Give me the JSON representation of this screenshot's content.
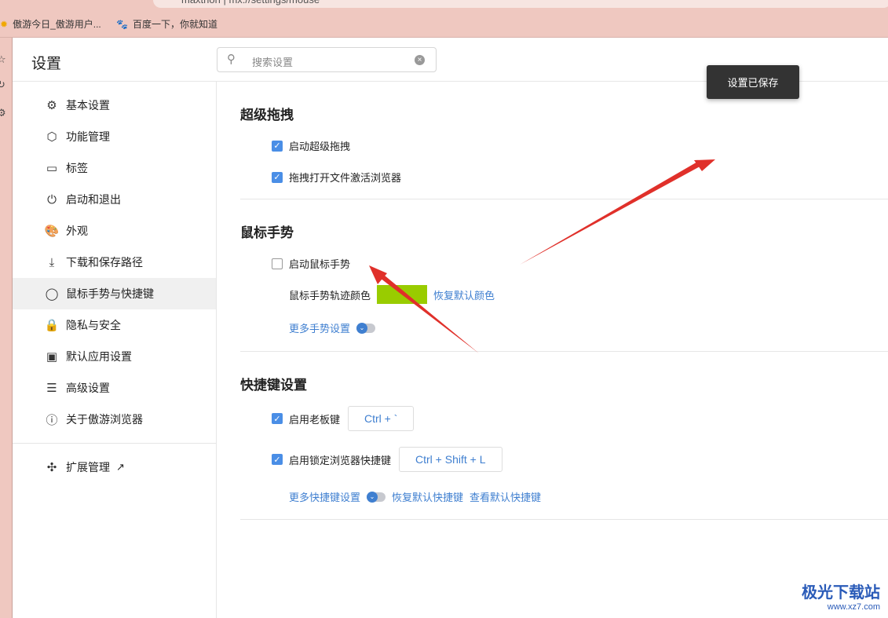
{
  "browser": {
    "address": "maxthon | mx://settings/mouse",
    "bookmarks": [
      "傲游今日_傲游用户...",
      "百度一下，你就知道"
    ]
  },
  "header": {
    "title": "设置",
    "search_placeholder": "搜索设置"
  },
  "sidebar": {
    "items": [
      {
        "label": "基本设置",
        "icon": "⚙"
      },
      {
        "label": "功能管理",
        "icon": "⬡"
      },
      {
        "label": "标签",
        "icon": "▭"
      },
      {
        "label": "启动和退出",
        "icon": "⏻"
      },
      {
        "label": "外观",
        "icon": "🎨"
      },
      {
        "label": "下载和保存路径",
        "icon": "⤓"
      },
      {
        "label": "鼠标手势与快捷键",
        "icon": "◯"
      },
      {
        "label": "隐私与安全",
        "icon": "🔒"
      },
      {
        "label": "默认应用设置",
        "icon": "▣"
      },
      {
        "label": "高级设置",
        "icon": "☰"
      },
      {
        "label": "关于傲游浏览器",
        "icon": "ⓘ"
      }
    ],
    "active_index": 6,
    "extensions": "扩展管理"
  },
  "sections": {
    "drag": {
      "title": "超级拖拽",
      "opt1": "启动超级拖拽",
      "opt1_checked": true,
      "opt2": "拖拽打开文件激活浏览器",
      "opt2_checked": true
    },
    "gesture": {
      "title": "鼠标手势",
      "opt1": "启动鼠标手势",
      "opt1_checked": false,
      "color_label": "鼠标手势轨迹颜色",
      "color": "#99cc00",
      "reset_color": "恢复默认颜色",
      "more": "更多手势设置"
    },
    "shortcut": {
      "title": "快捷键设置",
      "boss": "启用老板键",
      "boss_checked": true,
      "boss_key": "Ctrl + `",
      "lock": "启用锁定浏览器快捷键",
      "lock_checked": true,
      "lock_key": "Ctrl + Shift + L",
      "more": "更多快捷键设置",
      "reset": "恢复默认快捷键",
      "view": "查看默认快捷键"
    }
  },
  "toast": "设置已保存",
  "watermark": {
    "name": "极光下载站",
    "url": "www.xz7.com"
  }
}
